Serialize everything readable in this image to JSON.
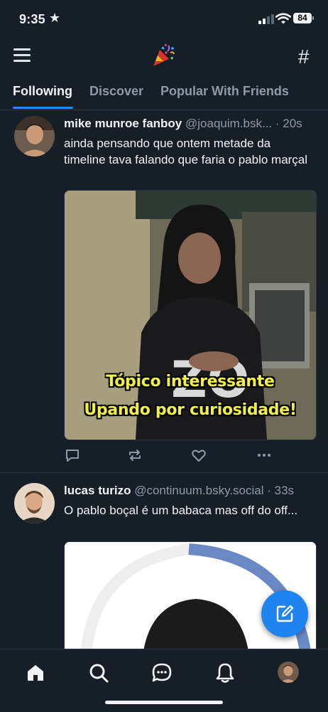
{
  "status_bar": {
    "time": "9:35",
    "battery": "84"
  },
  "header": {
    "menu_icon": "hamburger-menu-icon",
    "logo_icon": "party-popper-icon",
    "feeds_icon": "hash-icon"
  },
  "tabs": [
    {
      "label": "Following",
      "active": true
    },
    {
      "label": "Discover",
      "active": false
    },
    {
      "label": "Popular With Friends",
      "active": false
    }
  ],
  "posts": [
    {
      "author": "mike munroe fanboy",
      "handle": "@joaquim.bsk...",
      "time": "· 20s",
      "text": "ainda pensando que ontem metade da timeline tava falando que faria o pablo marçal",
      "media_caption": [
        "Tópico interessante",
        "Upando por curiosidade!"
      ],
      "jersey_text": "ZO"
    },
    {
      "author": "lucas turizo",
      "handle": "@continuum.bsky.social",
      "time": "· 33s",
      "text": "O pablo boçal é um babaca mas off do off..."
    }
  ],
  "colors": {
    "background": "#161e27",
    "accent": "#1f8bff",
    "fab": "#1d84f0",
    "muted": "#8e9aa8"
  },
  "bottom_nav": [
    "home-icon",
    "search-icon",
    "chat-icon",
    "notifications-bell-icon",
    "profile-avatar"
  ]
}
